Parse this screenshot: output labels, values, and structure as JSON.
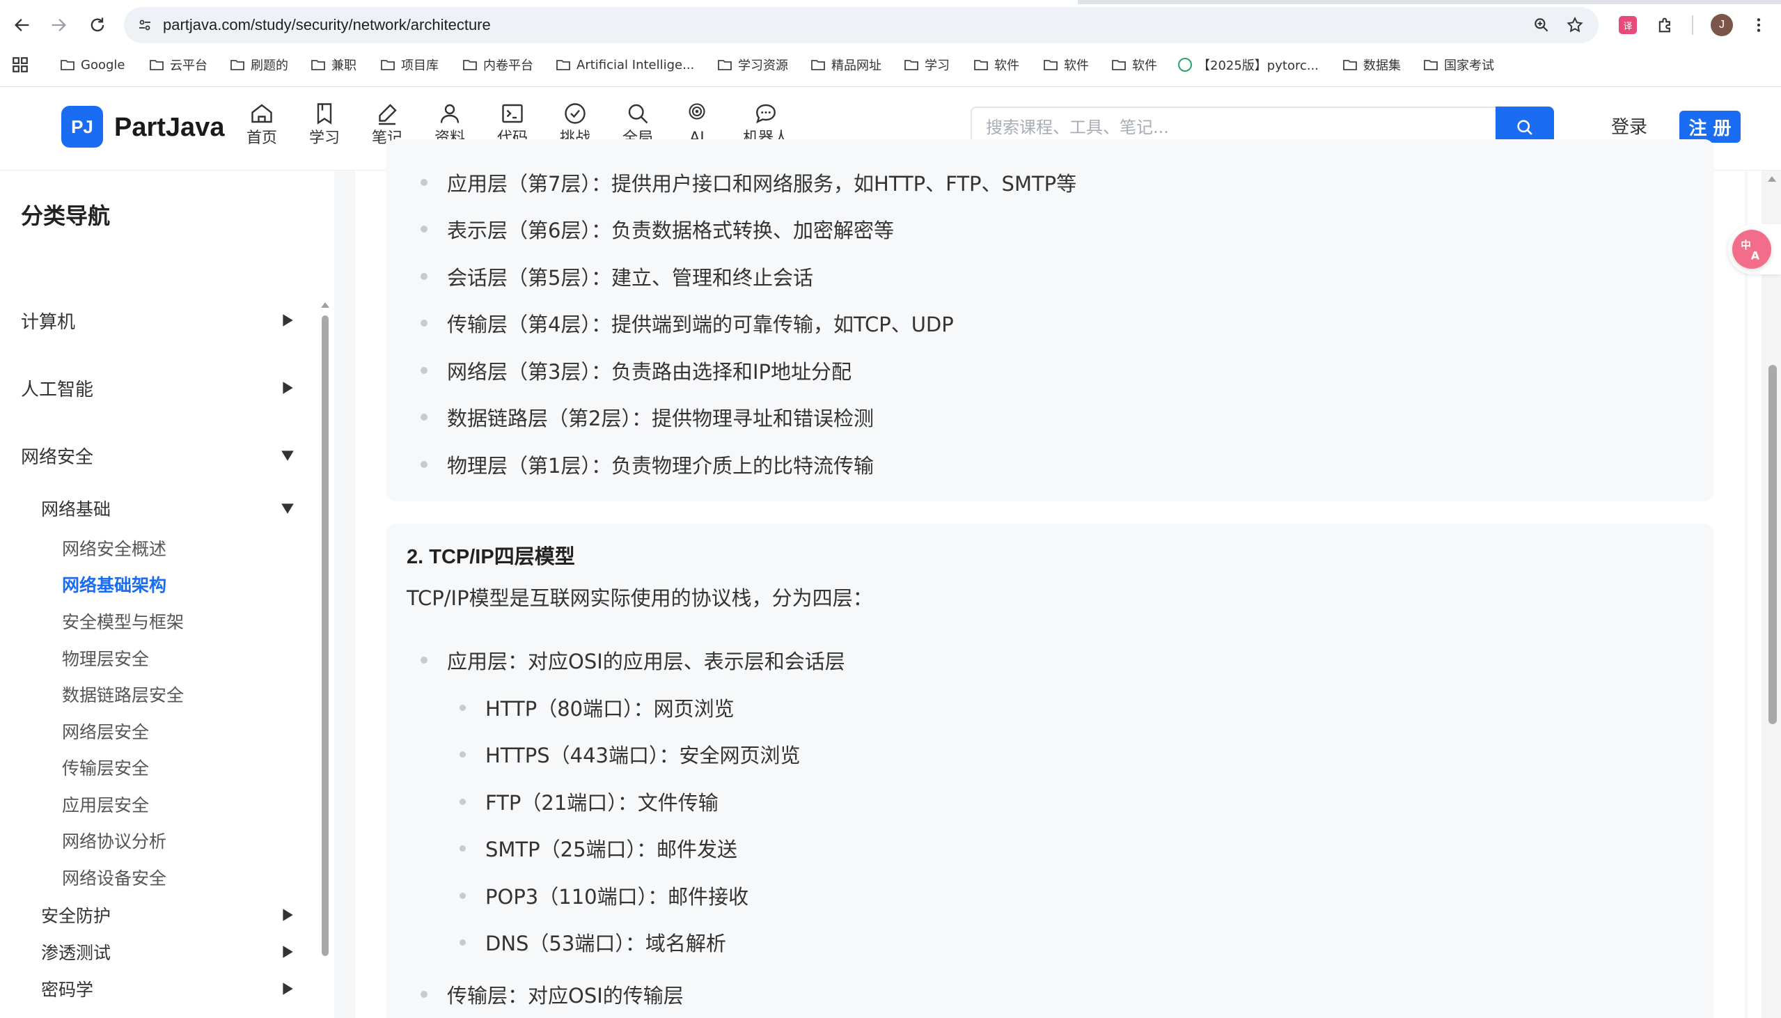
{
  "browser": {
    "url": "partjava.com/study/security/network/architecture",
    "avatar_letter": "J",
    "bookmarks": [
      {
        "label": "Google",
        "type": "folder"
      },
      {
        "label": "云平台",
        "type": "folder"
      },
      {
        "label": "刷题的",
        "type": "folder"
      },
      {
        "label": "兼职",
        "type": "folder"
      },
      {
        "label": "项目库",
        "type": "folder"
      },
      {
        "label": "内卷平台",
        "type": "folder"
      },
      {
        "label": "Artificial Intellige...",
        "type": "folder"
      },
      {
        "label": "学习资源",
        "type": "folder"
      },
      {
        "label": "精品网址",
        "type": "folder"
      },
      {
        "label": "学习",
        "type": "folder"
      },
      {
        "label": "软件",
        "type": "folder"
      },
      {
        "label": "软件",
        "type": "folder"
      },
      {
        "label": "软件",
        "type": "folder"
      },
      {
        "label": "【2025版】pytorc...",
        "type": "site"
      },
      {
        "label": "数据集",
        "type": "folder"
      },
      {
        "label": "国家考试",
        "type": "folder"
      }
    ]
  },
  "header": {
    "logo_mark": "PJ",
    "logo_text": "PartJava",
    "nav": [
      {
        "label": "首页",
        "icon": "home-icon"
      },
      {
        "label": "学习",
        "icon": "bookmark-icon"
      },
      {
        "label": "笔记",
        "icon": "pen-icon"
      },
      {
        "label": "资料",
        "icon": "user-icon"
      },
      {
        "label": "代码",
        "icon": "terminal-icon"
      },
      {
        "label": "挑战",
        "icon": "check-circle-icon"
      },
      {
        "label": "全局",
        "icon": "search-icon"
      },
      {
        "label": "AI",
        "icon": "target-icon"
      },
      {
        "label": "机器人",
        "icon": "chat-icon"
      }
    ],
    "search_placeholder": "搜索课程、工具、笔记...",
    "login_label": "登录",
    "register_label": "注 册",
    "accent_color": "#1a6cf3"
  },
  "sidebar": {
    "title": "分类导航",
    "categories": [
      {
        "label": "计算机",
        "expanded": false
      },
      {
        "label": "人工智能",
        "expanded": false
      },
      {
        "label": "网络安全",
        "expanded": true
      }
    ],
    "group": {
      "label": "网络基础",
      "expanded": true
    },
    "items": [
      "网络安全概述",
      "网络基础架构",
      "安全模型与框架",
      "物理层安全",
      "数据链路层安全",
      "网络层安全",
      "传输层安全",
      "应用层安全",
      "网络协议分析",
      "网络设备安全"
    ],
    "active_item": "网络基础架构",
    "collapsed_groups": [
      "安全防护",
      "渗透测试",
      "密码学"
    ]
  },
  "content": {
    "osi_layers": [
      "应用层（第7层）：提供用户接口和网络服务，如HTTP、FTP、SMTP等",
      "表示层（第6层）：负责数据格式转换、加密解密等",
      "会话层（第5层）：建立、管理和终止会话",
      "传输层（第4层）：提供端到端的可靠传输，如TCP、UDP",
      "网络层（第3层）：负责路由选择和IP地址分配",
      "数据链路层（第2层）：提供物理寻址和错误检测",
      "物理层（第1层）：负责物理介质上的比特流传输"
    ],
    "tcpip_heading": "2. TCP/IP四层模型",
    "tcpip_desc": "TCP/IP模型是互联网实际使用的协议栈，分为四层：",
    "app_layer": "应用层：对应OSI的应用层、表示层和会话层",
    "app_protocols": [
      "HTTP（80端口）：网页浏览",
      "HTTPS（443端口）：安全网页浏览",
      "FTP（21端口）：文件传输",
      "SMTP（25端口）：邮件发送",
      "POP3（110端口）：邮件接收",
      "DNS（53端口）：域名解析"
    ],
    "transport_layer": "传输层：对应OSI的传输层"
  }
}
